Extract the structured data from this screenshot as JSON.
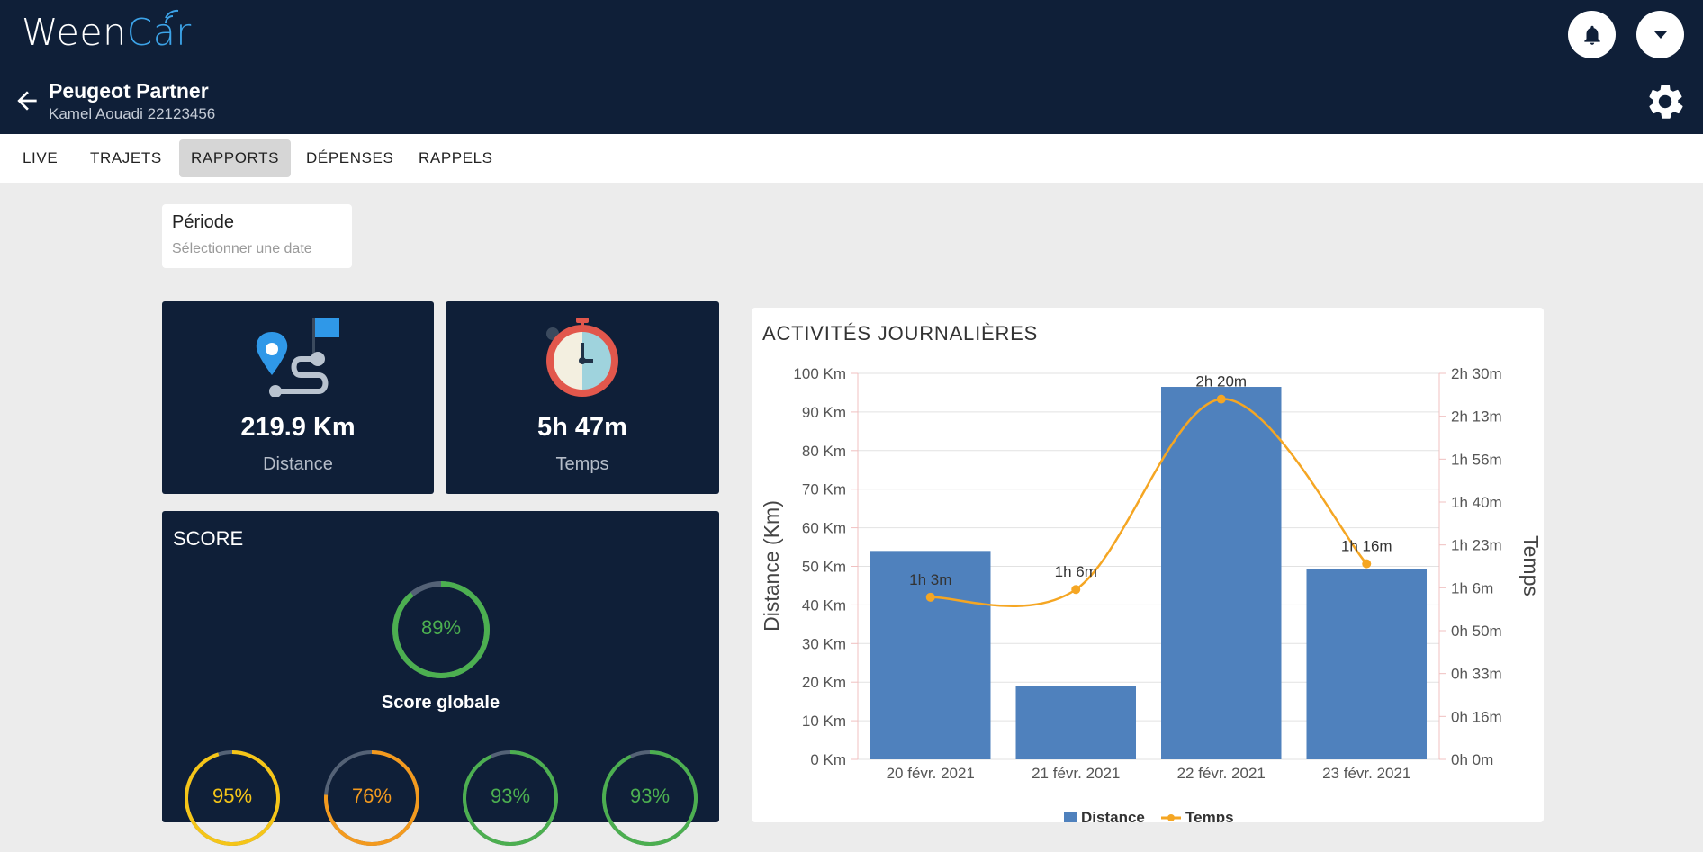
{
  "app": {
    "logo_main": "Ween",
    "logo_accent": "Car"
  },
  "vehicle": {
    "name": "Peugeot Partner",
    "driver": "Kamel Aouadi 22123456"
  },
  "tabs": [
    {
      "label": "LIVE",
      "active": false
    },
    {
      "label": "TRAJETS",
      "active": false
    },
    {
      "label": "RAPPORTS",
      "active": true
    },
    {
      "label": "DÉPENSES",
      "active": false
    },
    {
      "label": "RAPPELS",
      "active": false
    }
  ],
  "period": {
    "title": "Période",
    "placeholder": "Sélectionner une date"
  },
  "stats": {
    "distance": {
      "value": "219.9 Km",
      "label": "Distance"
    },
    "time": {
      "value": "5h 47m",
      "label": "Temps"
    }
  },
  "score": {
    "title": "SCORE",
    "global": {
      "value": 89,
      "text": "89%",
      "label": "Score globale",
      "color": "#4caf50"
    },
    "sub": [
      {
        "value": 95,
        "text": "95%",
        "color": "#f5c518"
      },
      {
        "value": 76,
        "text": "76%",
        "color": "#f39a1e"
      },
      {
        "value": 93,
        "text": "93%",
        "color": "#4caf50"
      },
      {
        "value": 93,
        "text": "93%",
        "color": "#4caf50"
      }
    ]
  },
  "chart_data": {
    "type": "bar",
    "title": "ACTIVITÉS JOURNALIÈRES",
    "categories": [
      "20 févr. 2021",
      "21 févr. 2021",
      "22 févr. 2021",
      "23 févr. 2021"
    ],
    "ylabel": "Distance (Km)",
    "y2label": "Temps",
    "ylim": [
      0,
      100
    ],
    "y_ticks": [
      "0  Km",
      "10 Km",
      "20 Km",
      "30 Km",
      "40 Km",
      "50 Km",
      "60 Km",
      "70 Km",
      "80 Km",
      "90 Km",
      "100 Km"
    ],
    "y2_ticks": [
      "0h 0m",
      "0h 16m",
      "0h 33m",
      "0h 50m",
      "1h 6m",
      "1h 23m",
      "1h 40m",
      "1h 56m",
      "2h 13m",
      "2h 30m"
    ],
    "y2lim_minutes": [
      0,
      150
    ],
    "series": [
      {
        "name": "Distance",
        "type": "bar",
        "color": "#4f81bd",
        "values": [
          54,
          19,
          96.5,
          49.2
        ]
      },
      {
        "name": "Temps",
        "type": "line",
        "color": "#f5a623",
        "values_minutes": [
          63,
          66,
          140,
          76
        ],
        "labels": [
          "1h 3m",
          "1h 6m",
          "2h 20m",
          "1h 16m"
        ]
      }
    ],
    "grid": true,
    "legend": "bottom"
  }
}
